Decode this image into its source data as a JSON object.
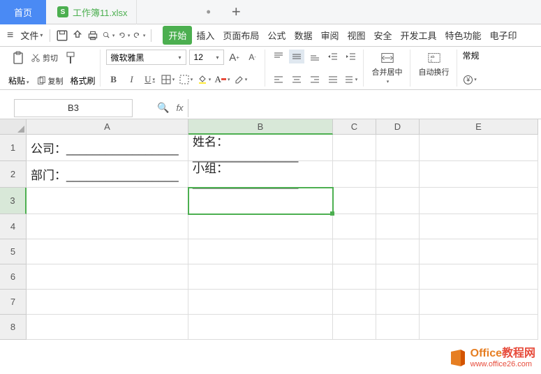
{
  "tabs": {
    "home": "首页",
    "file_icon": "S",
    "file_name": "工作簿11.xlsx",
    "modified": "•",
    "add": "+"
  },
  "menubar": {
    "file": "文件"
  },
  "menu_tabs": {
    "start": "开始",
    "insert": "插入",
    "page_layout": "页面布局",
    "formula": "公式",
    "data": "数据",
    "review": "审阅",
    "view": "视图",
    "security": "安全",
    "dev": "开发工具",
    "special": "特色功能",
    "electronic": "电子印"
  },
  "ribbon": {
    "paste": "粘贴",
    "cut": "剪切",
    "copy": "复制",
    "format_painter": "格式刷",
    "font_name": "微软雅黑",
    "font_size": "12",
    "bold": "B",
    "italic": "I",
    "underline": "U",
    "bigger": "A",
    "smaller": "A",
    "merge_center": "合并居中",
    "wrap": "自动换行",
    "general": "常规"
  },
  "formula_bar": {
    "name_box": "B3",
    "fx": "fx",
    "value": ""
  },
  "columns": [
    "A",
    "B",
    "C",
    "D",
    "E"
  ],
  "rows": [
    "1",
    "2",
    "3",
    "4",
    "5",
    "6",
    "7",
    "8"
  ],
  "cells": {
    "A1": "公司：_________________",
    "B1": "姓名：________________",
    "A2": "部门：_________________",
    "B2": "小组：________________"
  },
  "watermark": {
    "title_left": "Office",
    "title_right": "教程网",
    "url": "www.office26.com"
  },
  "chart_data": null
}
